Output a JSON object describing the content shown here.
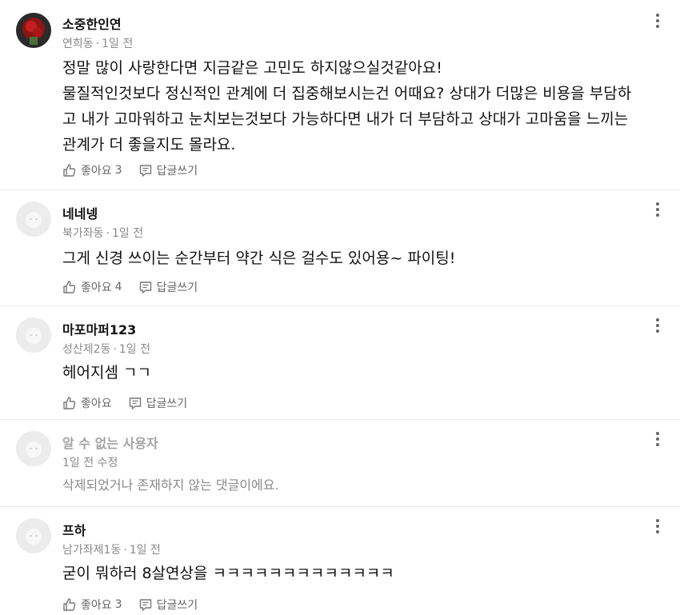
{
  "comments": [
    {
      "author": "소중한인연",
      "location": "연희동",
      "time": "1일 전",
      "lines": [
        "정말 많이 사랑한다면 지금같은 고민도 하지않으실것같아요!",
        "물질적인것보다 정신적인 관계에 더 집중해보시는건 어때요? 상대가 더많은 비용을 부담하",
        "고 내가 고마워하고 눈치보는것보다 가능하다면 내가 더 부담하고 상대가 고마움을 느끼는",
        "관계가 더 좋을지도 몰라요."
      ],
      "like_label": "좋아요",
      "like_count": "3",
      "reply_label": "답글쓰기"
    },
    {
      "author": "네네넹",
      "location": "북가좌동",
      "time": "1일 전",
      "lines": [
        "그게 신경 쓰이는 순간부터 약간 식은 걸수도 있어용~ 파이팅!"
      ],
      "like_label": "좋아요",
      "like_count": "4",
      "reply_label": "답글쓰기"
    },
    {
      "author": "마포마퍼123",
      "location": "성산제2동",
      "time": "1일 전",
      "lines": [
        "헤어지셈 ㄱㄱ"
      ],
      "like_label": "좋아요",
      "like_count": "",
      "reply_label": "답글쓰기"
    },
    {
      "author": "알 수 없는 사용자",
      "time": "1일 전 수정",
      "text": "삭제되었거나 존재하지 않는 댓글이에요."
    },
    {
      "author": "프하",
      "location": "남가좌제1동",
      "time": "1일 전",
      "lines": [
        "굳이 뭐하러 8살연상을 ㅋㅋㅋㅋㅋㅋㅋㅋㅋㅋㅋㅋㅋ"
      ],
      "like_label": "좋아요",
      "like_count": "3",
      "reply_label": "답글쓰기"
    }
  ],
  "icons": {
    "like": "thumbs-up-icon",
    "reply": "speech-bubble-icon",
    "more": "more-vertical-icon"
  },
  "colors": {
    "text": "#111111",
    "meta": "#8a8a8a",
    "action": "#666666",
    "deleted": "#a3a3a3",
    "divider": "#e9e9e9",
    "default_avatar": "#ececec"
  }
}
